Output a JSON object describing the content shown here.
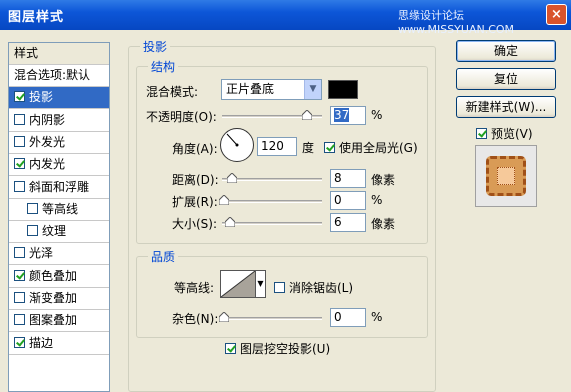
{
  "window": {
    "title": "图层样式",
    "watermark": "思缘设计论坛 www.MISSYUAN.COM",
    "close_label": "×"
  },
  "style_list": {
    "header": "样式",
    "items": [
      {
        "label": "混合选项:默认",
        "checkbox": null,
        "selected": false,
        "sub": false
      },
      {
        "label": "投影",
        "checkbox": true,
        "selected": true,
        "sub": false
      },
      {
        "label": "内阴影",
        "checkbox": false,
        "selected": false,
        "sub": false
      },
      {
        "label": "外发光",
        "checkbox": false,
        "selected": false,
        "sub": false
      },
      {
        "label": "内发光",
        "checkbox": true,
        "selected": false,
        "sub": false
      },
      {
        "label": "斜面和浮雕",
        "checkbox": false,
        "selected": false,
        "sub": false
      },
      {
        "label": "等高线",
        "checkbox": false,
        "selected": false,
        "sub": true
      },
      {
        "label": "纹理",
        "checkbox": false,
        "selected": false,
        "sub": true
      },
      {
        "label": "光泽",
        "checkbox": false,
        "selected": false,
        "sub": false
      },
      {
        "label": "颜色叠加",
        "checkbox": true,
        "selected": false,
        "sub": false
      },
      {
        "label": "渐变叠加",
        "checkbox": false,
        "selected": false,
        "sub": false
      },
      {
        "label": "图案叠加",
        "checkbox": false,
        "selected": false,
        "sub": false
      },
      {
        "label": "描边",
        "checkbox": true,
        "selected": false,
        "sub": false
      }
    ]
  },
  "drop_shadow": {
    "section_title": "投影",
    "structure": {
      "title": "结构",
      "blend_mode_label": "混合模式:",
      "blend_mode_value": "正片叠底",
      "color": "#000000",
      "opacity_label": "不透明度(O):",
      "opacity_value": "37",
      "opacity_unit": "%",
      "angle_label": "角度(A):",
      "angle_value": "120",
      "angle_unit": "度",
      "global_light_label": "使用全局光(G)",
      "global_light_checked": true,
      "distance_label": "距离(D):",
      "distance_value": "8",
      "distance_unit": "像素",
      "spread_label": "扩展(R):",
      "spread_value": "0",
      "spread_unit": "%",
      "size_label": "大小(S):",
      "size_value": "6",
      "size_unit": "像素"
    },
    "quality": {
      "title": "品质",
      "contour_label": "等高线:",
      "anti_alias_label": "消除锯齿(L)",
      "anti_alias_checked": false,
      "noise_label": "杂色(N):",
      "noise_value": "0",
      "noise_unit": "%"
    },
    "knockout_label": "图层挖空投影(U)",
    "knockout_checked": true
  },
  "buttons": {
    "ok": "确定",
    "reset": "复位",
    "new_style": "新建样式(W)...",
    "preview_label": "预览(V)",
    "preview_checked": true
  }
}
